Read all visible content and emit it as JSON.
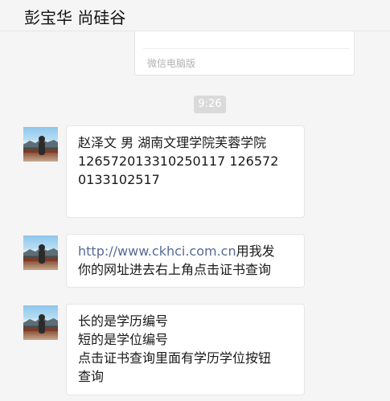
{
  "header": {
    "title": "彭宝华 尚硅谷"
  },
  "previous_message": {
    "source_label": "微信电脑版"
  },
  "timestamp": "9:26",
  "messages": [
    {
      "lines": [
        "赵泽文 男 湖南文理学院芙蓉学院",
        "12657201331025011​7 126572",
        "0133102517"
      ]
    },
    {
      "link": "http://www.ckhci.com.cn",
      "line1_rest": "用我发",
      "line2": "你的网址进去右上角点击证书查询"
    },
    {
      "lines": [
        "长的是学历编号",
        "短的是学位编号",
        "点击证书查询里面有学历学位按钮",
        "查询"
      ]
    }
  ],
  "colors": {
    "background": "#f5f5f5",
    "bubble": "#ffffff",
    "link": "#576b95",
    "time_badge": "#dadada"
  }
}
